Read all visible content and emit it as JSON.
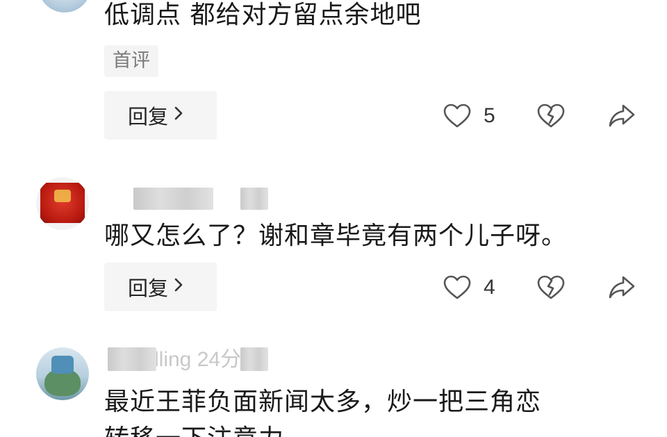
{
  "comments": [
    {
      "text": "低调点 都给对方留点余地吧",
      "tag": "首评",
      "reply_label": "回复",
      "likes": "5"
    },
    {
      "text": "哪又怎么了？谢和章毕竟有两个儿子呀。",
      "reply_label": "回复",
      "likes": "4"
    },
    {
      "partial_name": "lling 24分",
      "text_line1": "最近王菲负面新闻太多，炒一把三角恋",
      "text_line2": "转移一下注意力"
    }
  ],
  "icons": {
    "like": "heart-outline-icon",
    "dislike": "broken-heart-icon",
    "share": "share-arrow-icon",
    "reply_chevron": "chevron-right-icon"
  },
  "colors": {
    "text": "#1a1a1a",
    "tag_bg": "#f4f4f4",
    "tag_text": "#7a7a7a",
    "button_bg": "#f5f5f5",
    "icon": "#555555"
  }
}
